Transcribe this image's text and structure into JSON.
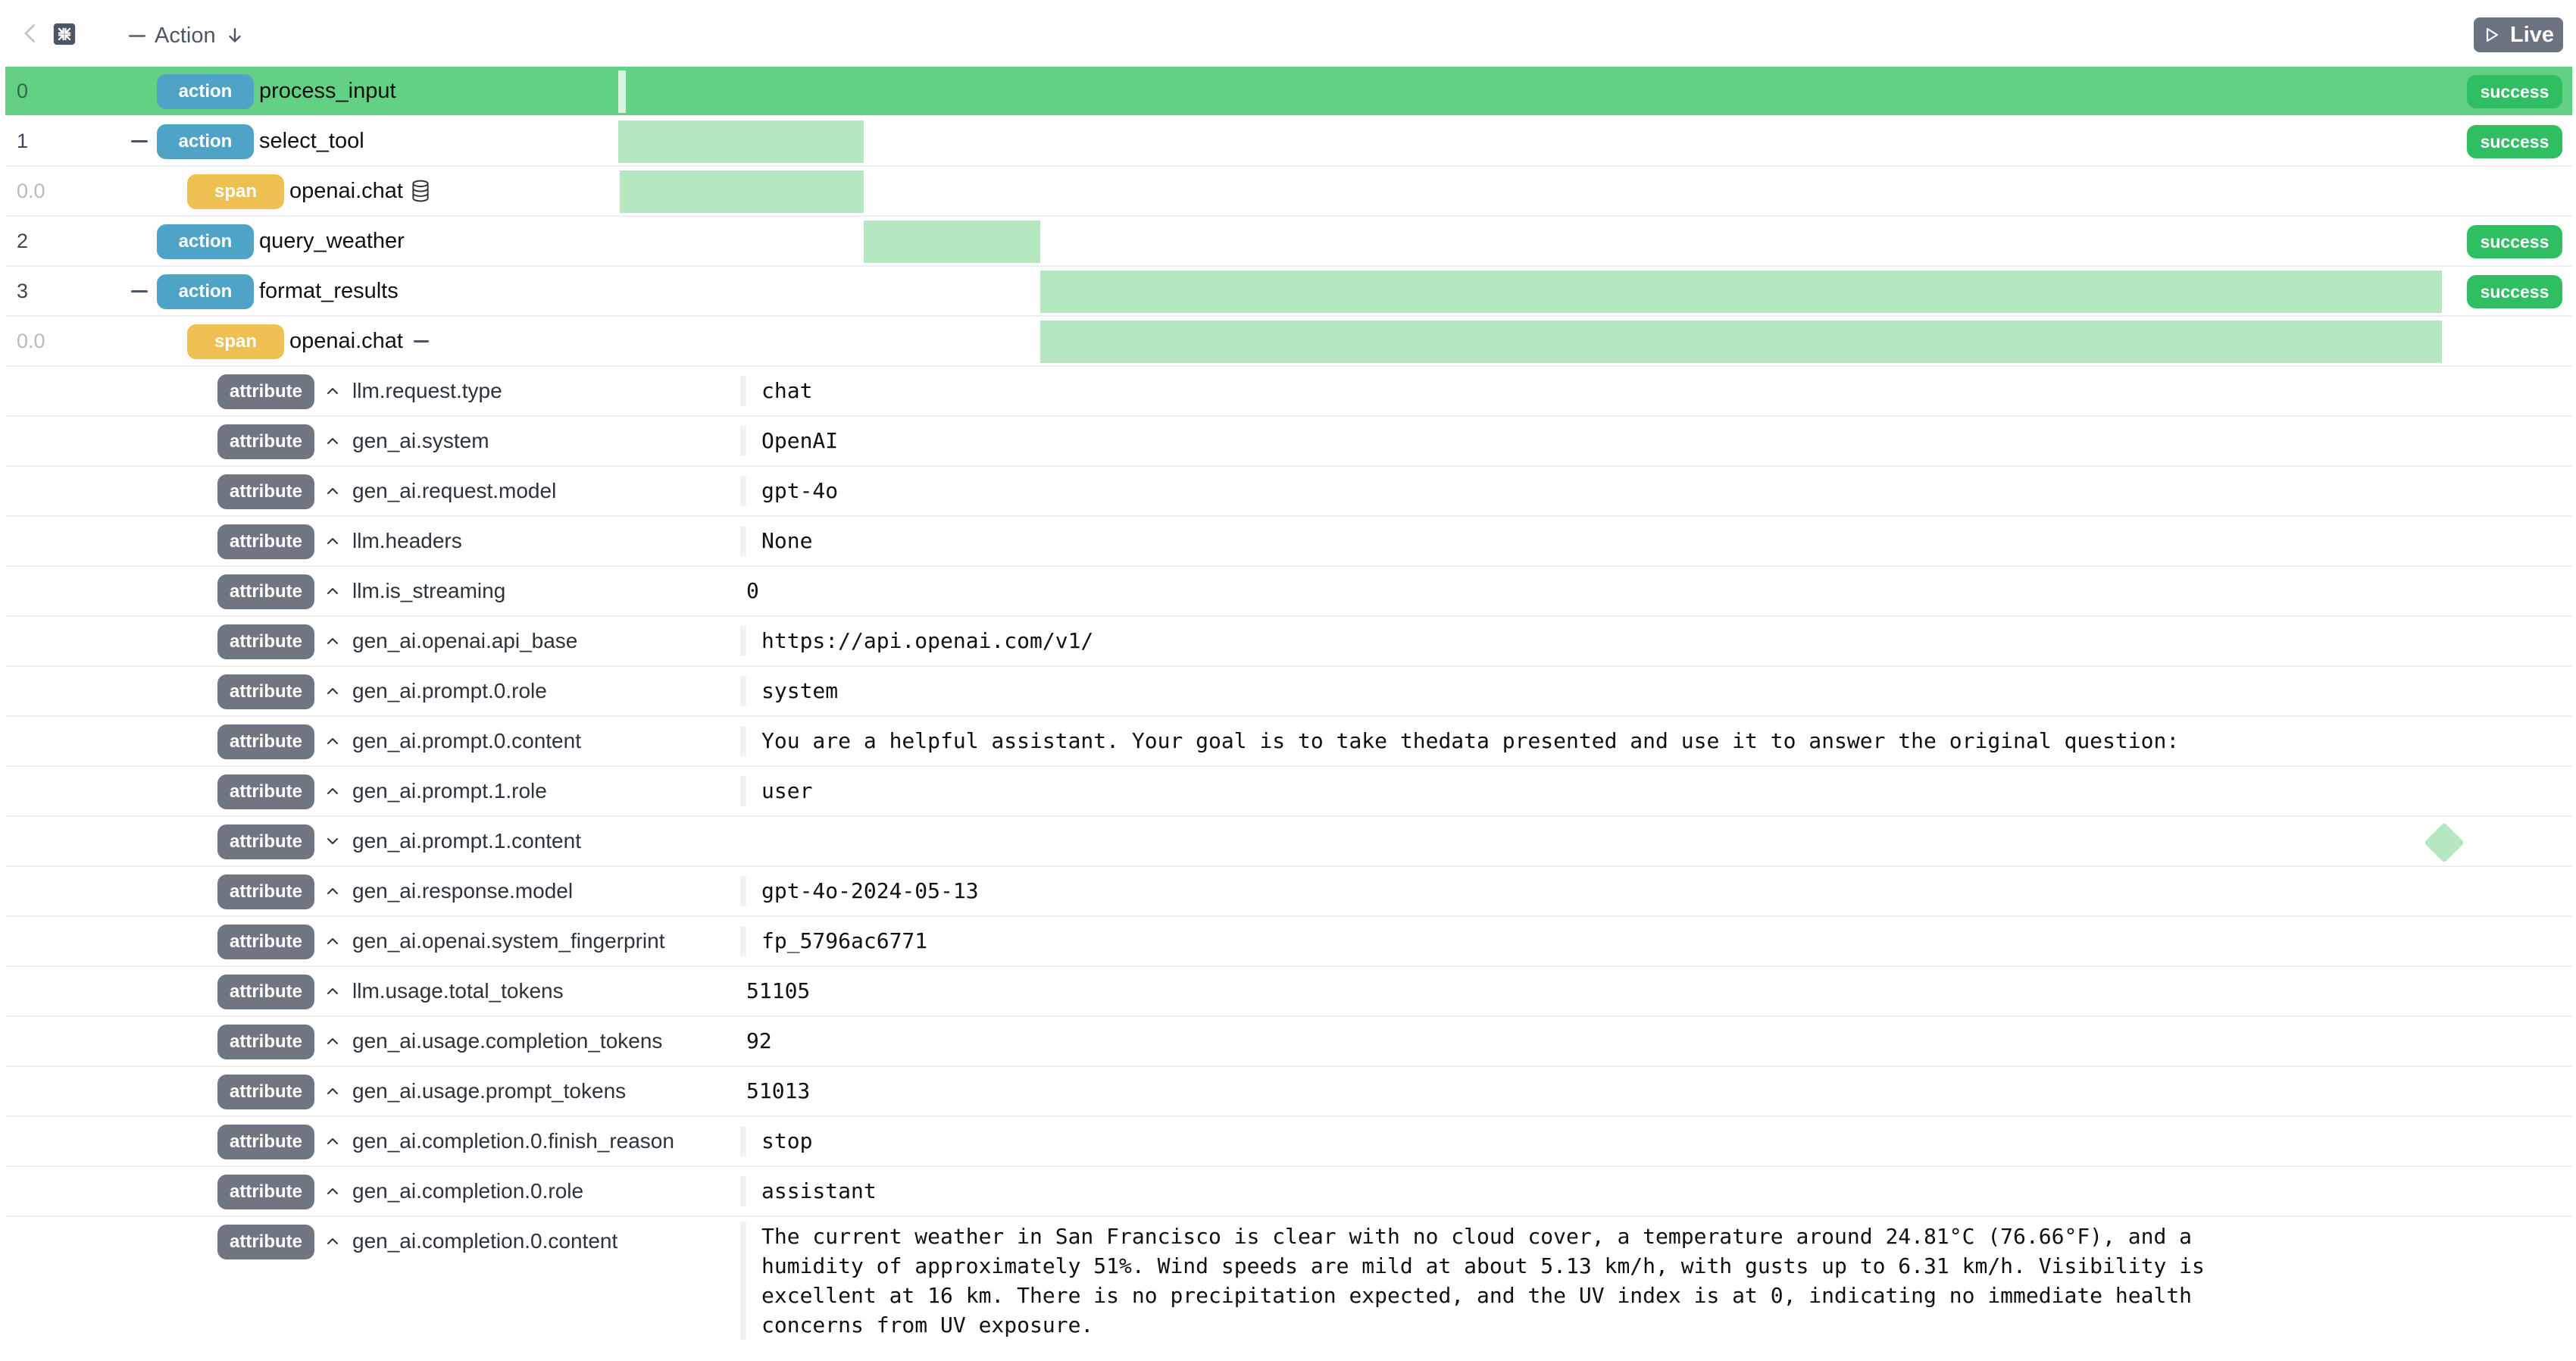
{
  "header": {
    "column_title": "Action",
    "live_label": "Live",
    "icons": [
      "chevron-left-icon",
      "collapse-all-icon",
      "arrow-down-icon",
      "play-icon"
    ]
  },
  "colors": {
    "action_tag": "#4fa3c7",
    "span_tag": "#eec052",
    "attribute_tag": "#6f7682",
    "success": "#2fbf62",
    "selected_row": "#62d183",
    "timeline_bar": "#b5e8c1"
  },
  "rows": [
    {
      "index": "0",
      "tag": "action",
      "name": "process_input",
      "status": "success"
    },
    {
      "index": "1",
      "tag": "action",
      "name": "select_tool",
      "status": "success"
    },
    {
      "index": "0.0",
      "tag": "span",
      "name": "openai.chat"
    },
    {
      "index": "2",
      "tag": "action",
      "name": "query_weather",
      "status": "success"
    },
    {
      "index": "3",
      "tag": "action",
      "name": "format_results",
      "status": "success"
    },
    {
      "index": "0.0",
      "tag": "span",
      "name": "openai.chat"
    }
  ],
  "attributes": [
    {
      "tag": "attribute",
      "key": "llm.request.type",
      "value": "chat"
    },
    {
      "tag": "attribute",
      "key": "gen_ai.system",
      "value": "OpenAI"
    },
    {
      "tag": "attribute",
      "key": "gen_ai.request.model",
      "value": "gpt-4o"
    },
    {
      "tag": "attribute",
      "key": "llm.headers",
      "value": "None"
    },
    {
      "tag": "attribute",
      "key": "llm.is_streaming",
      "value": "0"
    },
    {
      "tag": "attribute",
      "key": "gen_ai.openai.api_base",
      "value": "https://api.openai.com/v1/"
    },
    {
      "tag": "attribute",
      "key": "gen_ai.prompt.0.role",
      "value": "system"
    },
    {
      "tag": "attribute",
      "key": "gen_ai.prompt.0.content",
      "value": "You are a helpful assistant. Your goal is to take thedata presented and use it to answer the original question:"
    },
    {
      "tag": "attribute",
      "key": "gen_ai.prompt.1.role",
      "value": "user"
    },
    {
      "tag": "attribute",
      "key": "gen_ai.prompt.1.content",
      "value": ""
    },
    {
      "tag": "attribute",
      "key": "gen_ai.response.model",
      "value": "gpt-4o-2024-05-13"
    },
    {
      "tag": "attribute",
      "key": "gen_ai.openai.system_fingerprint",
      "value": "fp_5796ac6771"
    },
    {
      "tag": "attribute",
      "key": "llm.usage.total_tokens",
      "value": "51105"
    },
    {
      "tag": "attribute",
      "key": "gen_ai.usage.completion_tokens",
      "value": "92"
    },
    {
      "tag": "attribute",
      "key": "gen_ai.usage.prompt_tokens",
      "value": "51013"
    },
    {
      "tag": "attribute",
      "key": "gen_ai.completion.0.finish_reason",
      "value": "stop"
    },
    {
      "tag": "attribute",
      "key": "gen_ai.completion.0.role",
      "value": "assistant"
    },
    {
      "tag": "attribute",
      "key": "gen_ai.completion.0.content",
      "value": "The current weather in San Francisco is clear with no cloud cover, a temperature around 24.81°C (76.66°F), and a humidity of approximately 51%. Wind speeds are mild at about 5.13 km/h, with gusts up to 6.31 km/h. Visibility is excellent at 16 km. There is no precipitation expected, and the UV index is at 0, indicating no immediate health concerns from UV exposure."
    }
  ]
}
